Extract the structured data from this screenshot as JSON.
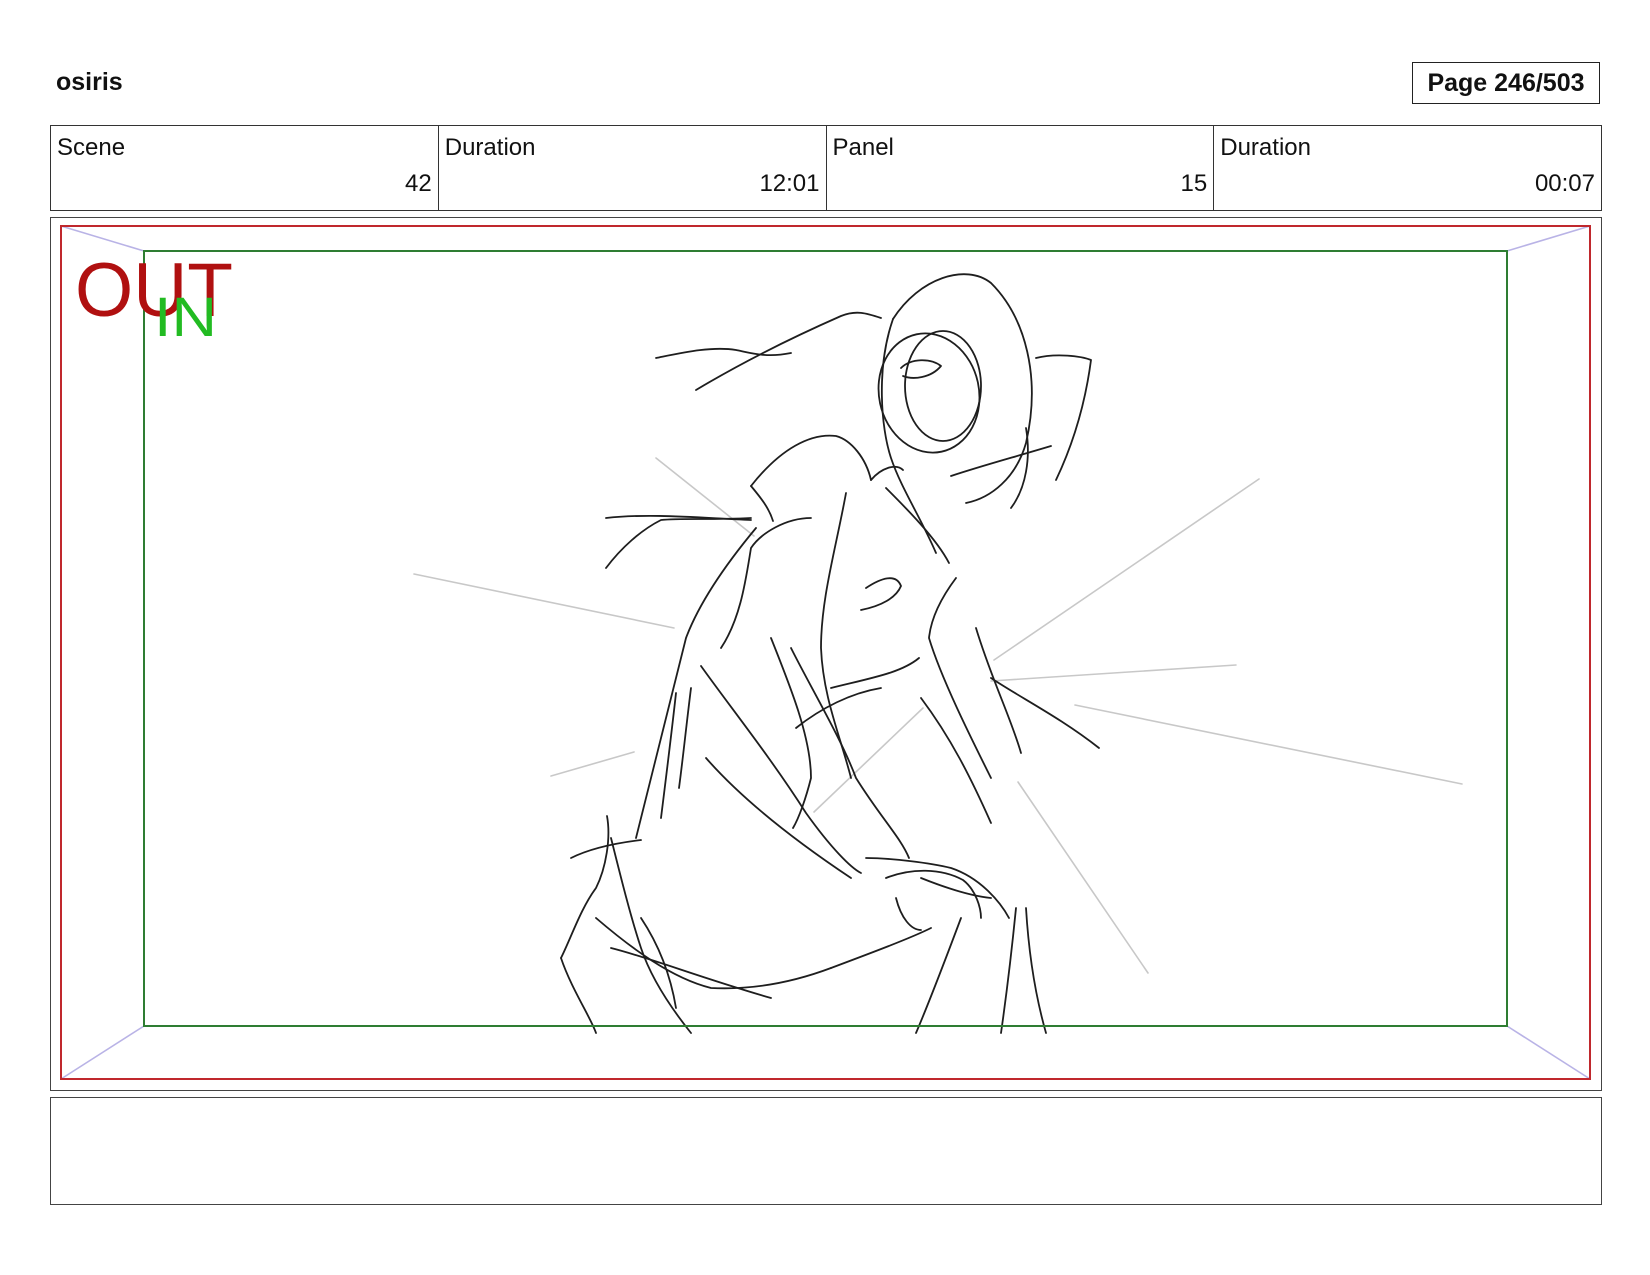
{
  "header": {
    "project_title": "osiris",
    "page_label": "Page 246/503"
  },
  "info": {
    "scene_label": "Scene",
    "scene_value": "42",
    "scene_duration_label": "Duration",
    "scene_duration_value": "12:01",
    "panel_label": "Panel",
    "panel_value": "15",
    "panel_duration_label": "Duration",
    "panel_duration_value": "00:07"
  },
  "frame": {
    "out_label": "OUT",
    "in_label": "IN",
    "out_color": "#b01010",
    "in_color": "#22bb22",
    "outer_frame_color": "#c0282d",
    "inner_frame_color": "#2e7d32"
  },
  "notes": {
    "text": ""
  }
}
